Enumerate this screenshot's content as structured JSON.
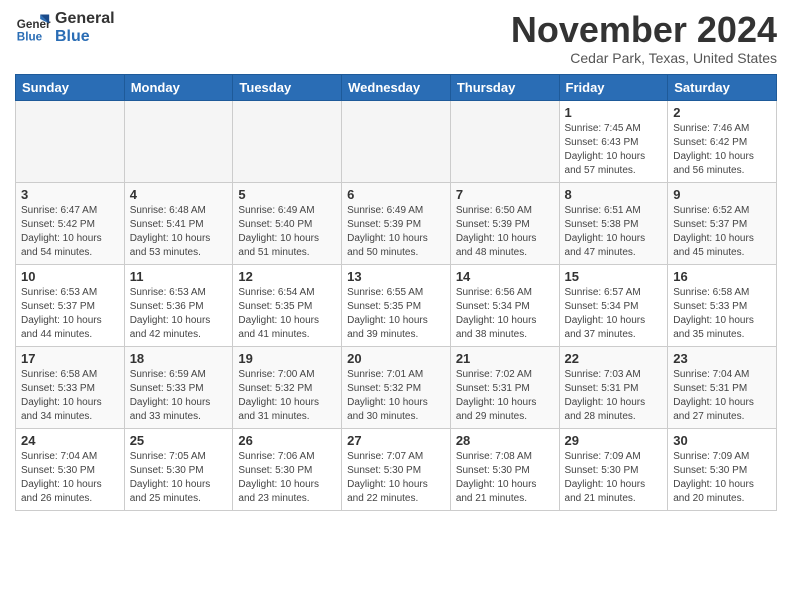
{
  "header": {
    "logo_line1": "General",
    "logo_line2": "Blue",
    "month": "November 2024",
    "location": "Cedar Park, Texas, United States"
  },
  "days_of_week": [
    "Sunday",
    "Monday",
    "Tuesday",
    "Wednesday",
    "Thursday",
    "Friday",
    "Saturday"
  ],
  "weeks": [
    [
      {
        "day": "",
        "empty": true
      },
      {
        "day": "",
        "empty": true
      },
      {
        "day": "",
        "empty": true
      },
      {
        "day": "",
        "empty": true
      },
      {
        "day": "",
        "empty": true
      },
      {
        "day": "1",
        "sunrise": "7:45 AM",
        "sunset": "6:43 PM",
        "daylight": "10 hours and 57 minutes."
      },
      {
        "day": "2",
        "sunrise": "7:46 AM",
        "sunset": "6:42 PM",
        "daylight": "10 hours and 56 minutes."
      }
    ],
    [
      {
        "day": "3",
        "sunrise": "6:47 AM",
        "sunset": "5:42 PM",
        "daylight": "10 hours and 54 minutes."
      },
      {
        "day": "4",
        "sunrise": "6:48 AM",
        "sunset": "5:41 PM",
        "daylight": "10 hours and 53 minutes."
      },
      {
        "day": "5",
        "sunrise": "6:49 AM",
        "sunset": "5:40 PM",
        "daylight": "10 hours and 51 minutes."
      },
      {
        "day": "6",
        "sunrise": "6:49 AM",
        "sunset": "5:39 PM",
        "daylight": "10 hours and 50 minutes."
      },
      {
        "day": "7",
        "sunrise": "6:50 AM",
        "sunset": "5:39 PM",
        "daylight": "10 hours and 48 minutes."
      },
      {
        "day": "8",
        "sunrise": "6:51 AM",
        "sunset": "5:38 PM",
        "daylight": "10 hours and 47 minutes."
      },
      {
        "day": "9",
        "sunrise": "6:52 AM",
        "sunset": "5:37 PM",
        "daylight": "10 hours and 45 minutes."
      }
    ],
    [
      {
        "day": "10",
        "sunrise": "6:53 AM",
        "sunset": "5:37 PM",
        "daylight": "10 hours and 44 minutes."
      },
      {
        "day": "11",
        "sunrise": "6:53 AM",
        "sunset": "5:36 PM",
        "daylight": "10 hours and 42 minutes."
      },
      {
        "day": "12",
        "sunrise": "6:54 AM",
        "sunset": "5:35 PM",
        "daylight": "10 hours and 41 minutes."
      },
      {
        "day": "13",
        "sunrise": "6:55 AM",
        "sunset": "5:35 PM",
        "daylight": "10 hours and 39 minutes."
      },
      {
        "day": "14",
        "sunrise": "6:56 AM",
        "sunset": "5:34 PM",
        "daylight": "10 hours and 38 minutes."
      },
      {
        "day": "15",
        "sunrise": "6:57 AM",
        "sunset": "5:34 PM",
        "daylight": "10 hours and 37 minutes."
      },
      {
        "day": "16",
        "sunrise": "6:58 AM",
        "sunset": "5:33 PM",
        "daylight": "10 hours and 35 minutes."
      }
    ],
    [
      {
        "day": "17",
        "sunrise": "6:58 AM",
        "sunset": "5:33 PM",
        "daylight": "10 hours and 34 minutes."
      },
      {
        "day": "18",
        "sunrise": "6:59 AM",
        "sunset": "5:33 PM",
        "daylight": "10 hours and 33 minutes."
      },
      {
        "day": "19",
        "sunrise": "7:00 AM",
        "sunset": "5:32 PM",
        "daylight": "10 hours and 31 minutes."
      },
      {
        "day": "20",
        "sunrise": "7:01 AM",
        "sunset": "5:32 PM",
        "daylight": "10 hours and 30 minutes."
      },
      {
        "day": "21",
        "sunrise": "7:02 AM",
        "sunset": "5:31 PM",
        "daylight": "10 hours and 29 minutes."
      },
      {
        "day": "22",
        "sunrise": "7:03 AM",
        "sunset": "5:31 PM",
        "daylight": "10 hours and 28 minutes."
      },
      {
        "day": "23",
        "sunrise": "7:04 AM",
        "sunset": "5:31 PM",
        "daylight": "10 hours and 27 minutes."
      }
    ],
    [
      {
        "day": "24",
        "sunrise": "7:04 AM",
        "sunset": "5:30 PM",
        "daylight": "10 hours and 26 minutes."
      },
      {
        "day": "25",
        "sunrise": "7:05 AM",
        "sunset": "5:30 PM",
        "daylight": "10 hours and 25 minutes."
      },
      {
        "day": "26",
        "sunrise": "7:06 AM",
        "sunset": "5:30 PM",
        "daylight": "10 hours and 23 minutes."
      },
      {
        "day": "27",
        "sunrise": "7:07 AM",
        "sunset": "5:30 PM",
        "daylight": "10 hours and 22 minutes."
      },
      {
        "day": "28",
        "sunrise": "7:08 AM",
        "sunset": "5:30 PM",
        "daylight": "10 hours and 21 minutes."
      },
      {
        "day": "29",
        "sunrise": "7:09 AM",
        "sunset": "5:30 PM",
        "daylight": "10 hours and 21 minutes."
      },
      {
        "day": "30",
        "sunrise": "7:09 AM",
        "sunset": "5:30 PM",
        "daylight": "10 hours and 20 minutes."
      }
    ]
  ]
}
